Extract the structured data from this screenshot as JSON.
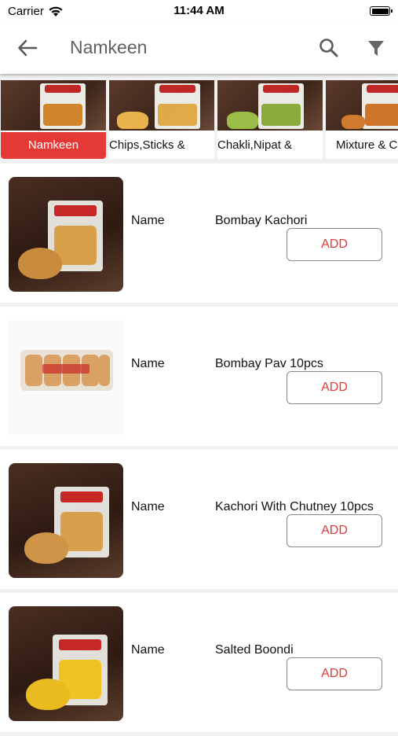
{
  "status_bar": {
    "carrier": "Carrier",
    "time": "11:44 AM",
    "wifi_icon": "wifi-icon",
    "battery_icon": "battery-icon"
  },
  "toolbar": {
    "title": "Namkeen",
    "back_icon": "arrow-left-icon",
    "search_icon": "search-icon",
    "filter_icon": "filter-icon"
  },
  "categories": [
    {
      "label": "Namkeen",
      "active": true
    },
    {
      "label": "Chips,Sticks &",
      "active": false
    },
    {
      "label": "Chakli,Nipat &",
      "active": false
    },
    {
      "label": "Mixture & Ch",
      "active": false
    }
  ],
  "products": [
    {
      "name_key": "Name",
      "name": "Bombay Kachori",
      "add_label": "ADD"
    },
    {
      "name_key": "Name",
      "name": "Bombay Pav 10pcs",
      "add_label": "ADD"
    },
    {
      "name_key": "Name",
      "name": "Kachori With Chutney 10pcs",
      "add_label": "ADD"
    },
    {
      "name_key": "Name",
      "name": "Salted Boondi",
      "add_label": "ADD"
    }
  ],
  "colors": {
    "accent": "#e53935",
    "background": "#f1f1f1",
    "title_gray": "#616161"
  }
}
